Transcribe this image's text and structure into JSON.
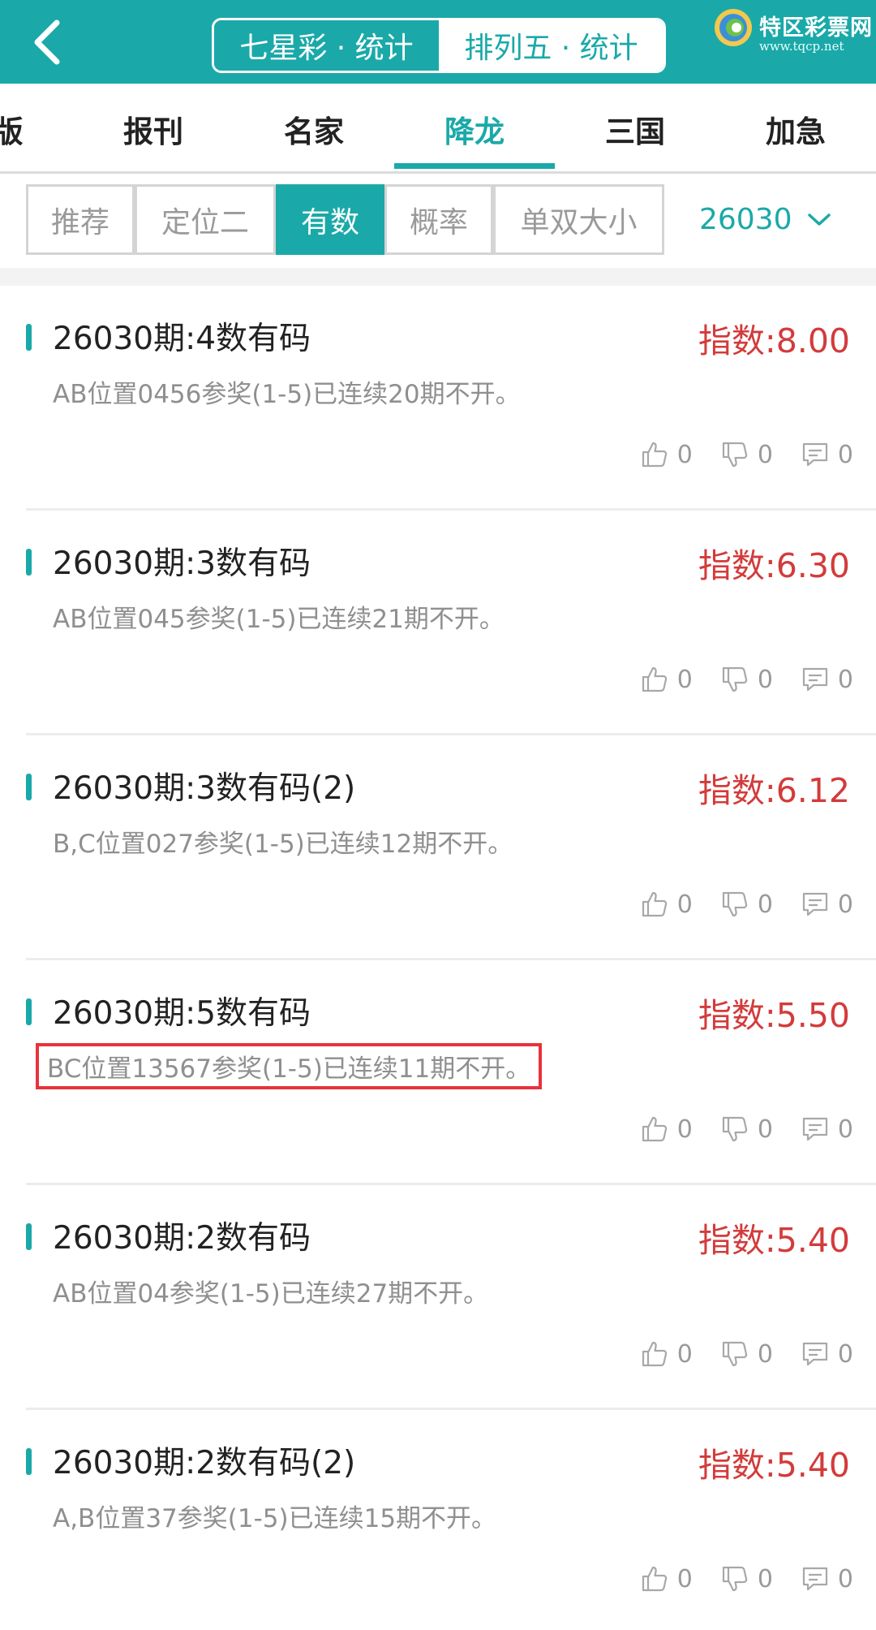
{
  "header": {
    "segments": [
      "七星彩 · 统计",
      "排列五 · 统计"
    ],
    "active_segment": 1,
    "logo_text": "特区彩票网",
    "logo_url": "www.tqcp.net"
  },
  "category_tabs": [
    "版",
    "报刊",
    "名家",
    "降龙",
    "三国",
    "加急"
  ],
  "filters": [
    "推荐",
    "定位二",
    "有数",
    "概率",
    "单双大小"
  ],
  "period_select": "26030",
  "cards": [
    {
      "title": "26030期:4数有码",
      "index": "指数:8.00",
      "desc": "AB位置0456参奖(1-5)已连续20期不开。",
      "likes": "0",
      "dislikes": "0",
      "comments": "0"
    },
    {
      "title": "26030期:3数有码",
      "index": "指数:6.30",
      "desc": "AB位置045参奖(1-5)已连续21期不开。",
      "likes": "0",
      "dislikes": "0",
      "comments": "0"
    },
    {
      "title": "26030期:3数有码(2)",
      "index": "指数:6.12",
      "desc": "B,C位置027参奖(1-5)已连续12期不开。",
      "likes": "0",
      "dislikes": "0",
      "comments": "0"
    },
    {
      "title": "26030期:5数有码",
      "index": "指数:5.50",
      "desc": "BC位置13567参奖(1-5)已连续11期不开。",
      "likes": "0",
      "dislikes": "0",
      "comments": "0"
    },
    {
      "title": "26030期:2数有码",
      "index": "指数:5.40",
      "desc": "AB位置04参奖(1-5)已连续27期不开。",
      "likes": "0",
      "dislikes": "0",
      "comments": "0"
    },
    {
      "title": "26030期:2数有码(2)",
      "index": "指数:5.40",
      "desc": "A,B位置37参奖(1-5)已连续15期不开。",
      "likes": "0",
      "dislikes": "0",
      "comments": "0"
    }
  ],
  "colors": {
    "accent": "#1aa9a8",
    "index_red": "#d33b3b",
    "highlight_red": "#e8323c"
  }
}
